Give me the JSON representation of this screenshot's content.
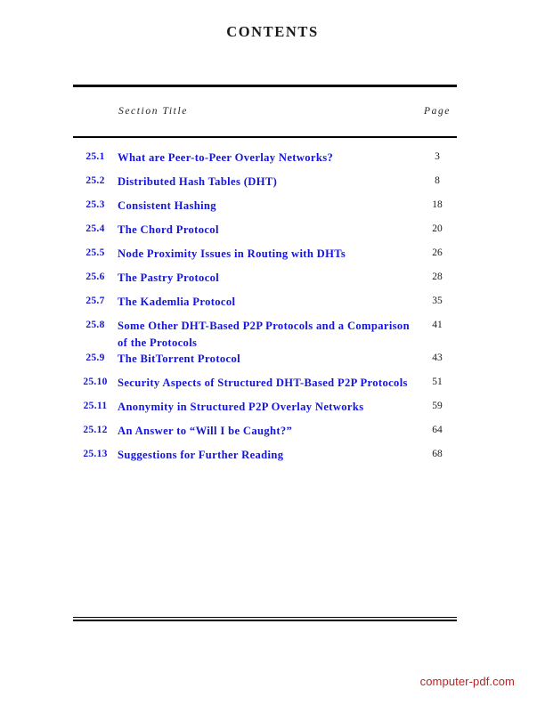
{
  "page": {
    "title": "CONTENTS",
    "watermark": "computer-pdf.com",
    "link_color": "#1414e0",
    "watermark_color": "#bb2222",
    "rule_color": "#000000"
  },
  "table": {
    "headers": {
      "number": "",
      "title": "Section Title",
      "page": "Page"
    },
    "rows": [
      {
        "number": "25.1",
        "title": "What are Peer-to-Peer Overlay Networks?",
        "page": "3"
      },
      {
        "number": "25.2",
        "title": "Distributed Hash Tables (DHT)",
        "page": "8"
      },
      {
        "number": "25.3",
        "title": "Consistent Hashing",
        "page": "18"
      },
      {
        "number": "25.4",
        "title": "The Chord Protocol",
        "page": "20"
      },
      {
        "number": "25.5",
        "title": "Node Proximity Issues in Routing with DHTs",
        "page": "26"
      },
      {
        "number": "25.6",
        "title": "The Pastry Protocol",
        "page": "28"
      },
      {
        "number": "25.7",
        "title": "The Kademlia Protocol",
        "page": "35"
      },
      {
        "number": "25.8",
        "title": "Some Other DHT-Based P2P Protocols and a Comparison of the Protocols",
        "page": "41"
      },
      {
        "number": "25.9",
        "title": "The BitTorrent Protocol",
        "page": "43"
      },
      {
        "number": "25.10",
        "title": "Security Aspects of Structured DHT-Based P2P Protocols",
        "page": "51"
      },
      {
        "number": "25.11",
        "title": "Anonymity in Structured P2P Overlay Networks",
        "page": "59"
      },
      {
        "number": "25.12",
        "title": "An Answer to “Will I be Caught?”",
        "page": "64"
      },
      {
        "number": "25.13",
        "title": "Suggestions for Further Reading",
        "page": "68"
      }
    ]
  }
}
